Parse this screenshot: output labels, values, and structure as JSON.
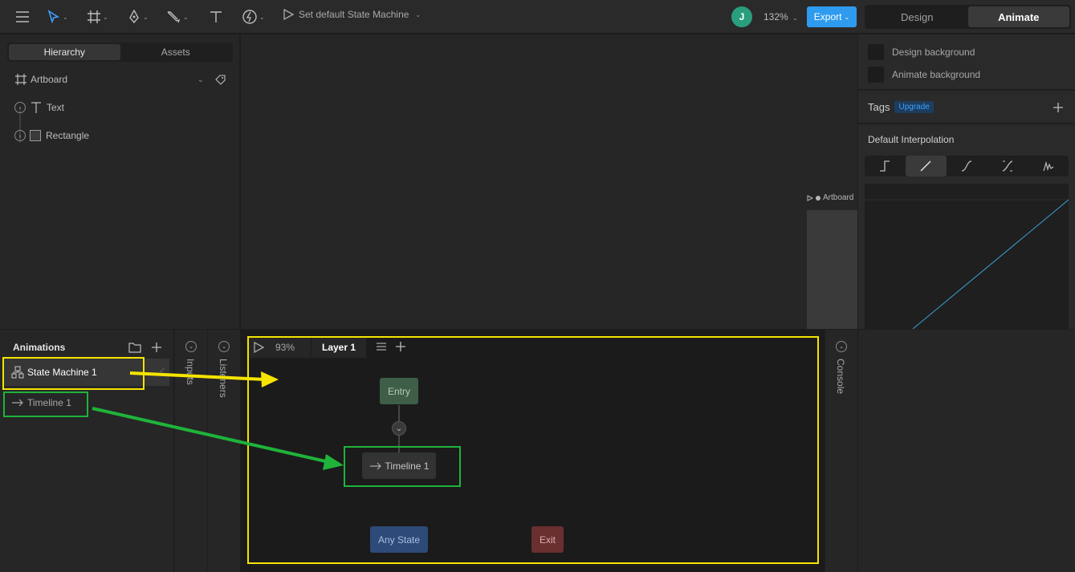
{
  "toolbar": {
    "state_machine_action": "Set default State Machine",
    "avatar_initial": "J",
    "zoom": "132%",
    "export_label": "Export",
    "modes": [
      "Design",
      "Animate"
    ],
    "active_mode": "Animate"
  },
  "left_panel": {
    "tabs": [
      "Hierarchy",
      "Assets"
    ],
    "active_tab": "Hierarchy",
    "root": "Artboard",
    "items": [
      {
        "label": "Text",
        "icon": "text-icon"
      },
      {
        "label": "Rectangle",
        "icon": "rectangle-icon"
      }
    ]
  },
  "stage": {
    "artboard_label": "Artboard"
  },
  "right_panel": {
    "backgrounds": [
      "Design background",
      "Animate background"
    ],
    "tags_label": "Tags",
    "upgrade_label": "Upgrade",
    "interpolation_title": "Default Interpolation",
    "interpolation_options": [
      "hold-icon",
      "linear-icon",
      "cubic-icon",
      "ease-icon",
      "elastic-icon"
    ],
    "active_interpolation": "linear-icon"
  },
  "animations": {
    "title": "Animations",
    "items": [
      {
        "label": "State Machine 1",
        "icon": "state-machine-icon"
      },
      {
        "label": "Timeline 1",
        "icon": "timeline-arrow-icon"
      }
    ]
  },
  "side_panels": {
    "inputs": "Inputs",
    "listeners": "Listeners",
    "console": "Console"
  },
  "state_machine": {
    "zoom": "93%",
    "layer_tab": "Layer 1",
    "nodes": {
      "entry": "Entry",
      "timeline": "Timeline 1",
      "any_state": "Any State",
      "exit": "Exit"
    }
  },
  "annotation_colors": {
    "yellow": "#f5e400",
    "green": "#1fb33a"
  }
}
